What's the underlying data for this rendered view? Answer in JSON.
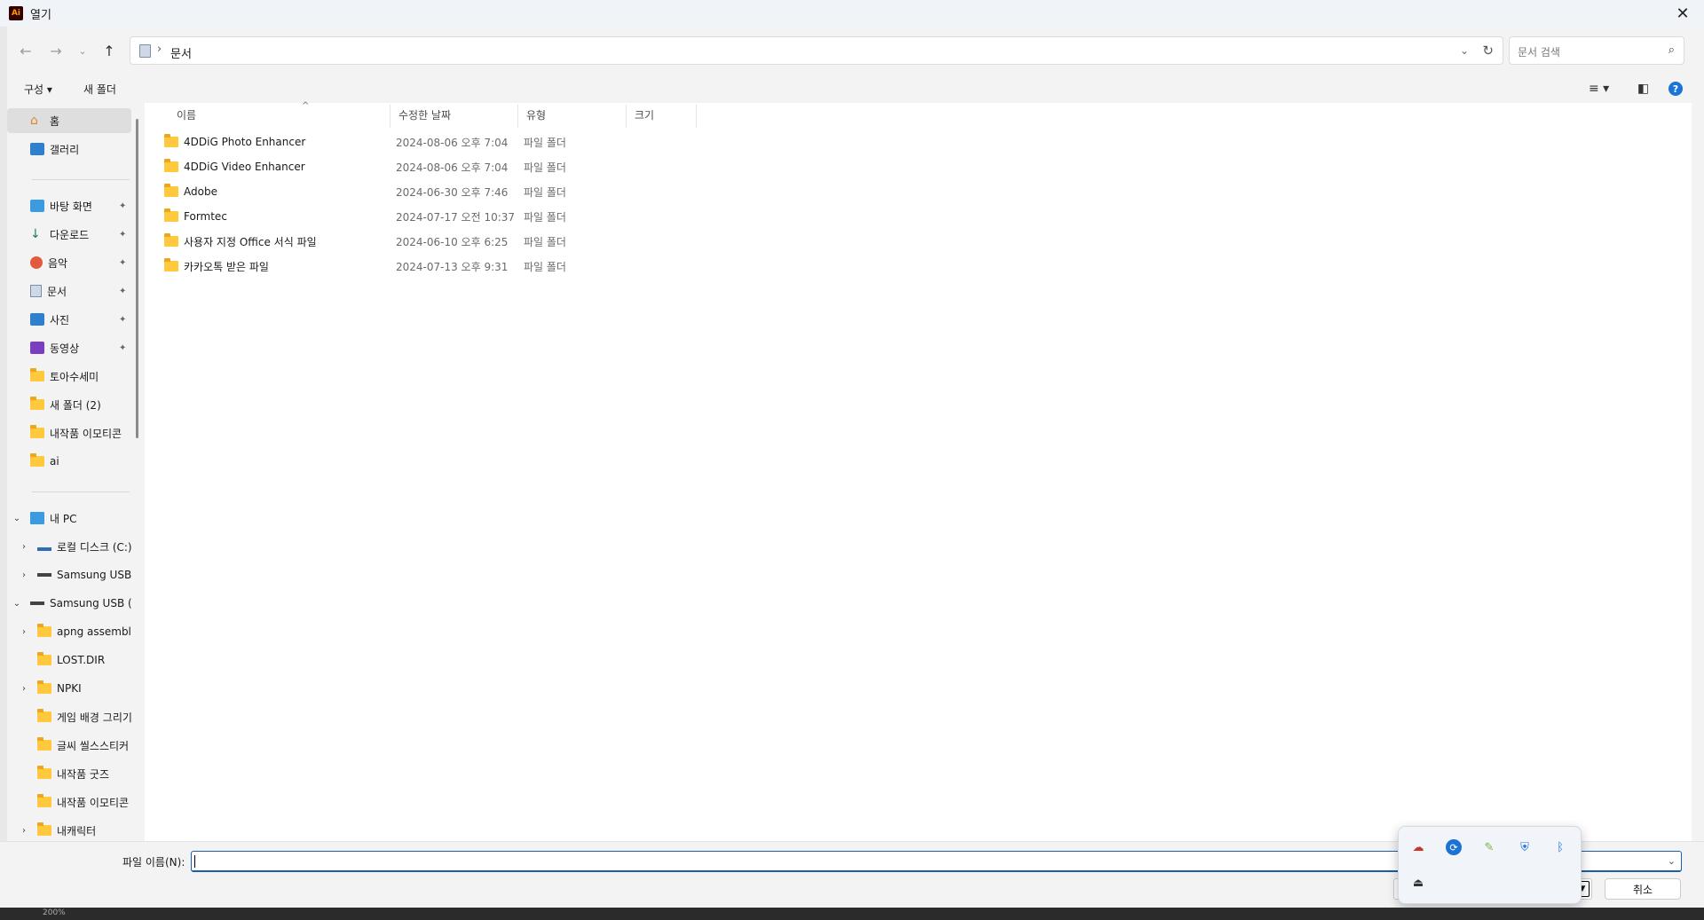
{
  "window": {
    "title": "열기",
    "app_icon": "Ai"
  },
  "nav": {
    "path_separator": "›",
    "path_current": "문서",
    "search_placeholder": "문서 검색"
  },
  "toolbar": {
    "organize": "구성 ▾",
    "new_folder": "새 폴더"
  },
  "sidebar": {
    "quick": [
      {
        "label": "홈",
        "icon": "home-icon"
      },
      {
        "label": "갤러리",
        "icon": "gallery-icon"
      }
    ],
    "pinned": [
      {
        "label": "바탕 화면",
        "icon": "desktop-icon"
      },
      {
        "label": "다운로드",
        "icon": "download-icon"
      },
      {
        "label": "음악",
        "icon": "music-icon"
      },
      {
        "label": "문서",
        "icon": "documents-icon"
      },
      {
        "label": "사진",
        "icon": "pictures-icon"
      },
      {
        "label": "동영상",
        "icon": "videos-icon"
      }
    ],
    "folders": [
      "토아수세미",
      "새 폴더 (2)",
      "내작품 이모티콘",
      "ai"
    ],
    "tree": [
      {
        "label": "내 PC",
        "chevron": "⌄",
        "indent": 0
      },
      {
        "label": "로컬 디스크 (C:)",
        "chevron": "›",
        "indent": 1
      },
      {
        "label": "Samsung USB",
        "chevron": "›",
        "indent": 1
      },
      {
        "label": "Samsung USB (",
        "chevron": "⌄",
        "indent": 0
      },
      {
        "label": "apng assembler",
        "chevron": "›",
        "indent": 1
      },
      {
        "label": "LOST.DIR",
        "chevron": "",
        "indent": 1
      },
      {
        "label": "NPKI",
        "chevron": "›",
        "indent": 1
      },
      {
        "label": "게임 배경 그리기",
        "chevron": "",
        "indent": 1
      },
      {
        "label": "글씨 씰스스티커",
        "chevron": "",
        "indent": 1
      },
      {
        "label": "내작품 굿즈",
        "chevron": "",
        "indent": 1
      },
      {
        "label": "내작품 이모티콘",
        "chevron": "",
        "indent": 1
      },
      {
        "label": "내캐릭터",
        "chevron": "›",
        "indent": 1
      }
    ]
  },
  "columns": {
    "name": "이름",
    "date": "수정한 날짜",
    "type": "유형",
    "size": "크기"
  },
  "files": [
    {
      "name": "4DDiG Photo Enhancer",
      "date": "2024-08-06 오후 7:04",
      "type": "파일 폴더"
    },
    {
      "name": "4DDiG Video Enhancer",
      "date": "2024-08-06 오후 7:04",
      "type": "파일 폴더"
    },
    {
      "name": "Adobe",
      "date": "2024-06-30 오후 7:46",
      "type": "파일 폴더"
    },
    {
      "name": "Formtec",
      "date": "2024-07-17 오전 10:37",
      "type": "파일 폴더"
    },
    {
      "name": "사용자 지정 Office 서식 파일",
      "date": "2024-06-10 오후 6:25",
      "type": "파일 폴더"
    },
    {
      "name": "카카오톡 받은 파일",
      "date": "2024-07-13 오후 9:31",
      "type": "파일 폴더"
    }
  ],
  "bottom": {
    "filename_label": "파일 이름(N):",
    "filename_value": "",
    "cancel": "취소"
  },
  "taskbar": {
    "zoom": "200%"
  },
  "colors": {
    "accent": "#1b5fa8",
    "folder": "#ffc83d",
    "selected_bg": "#dedede"
  }
}
